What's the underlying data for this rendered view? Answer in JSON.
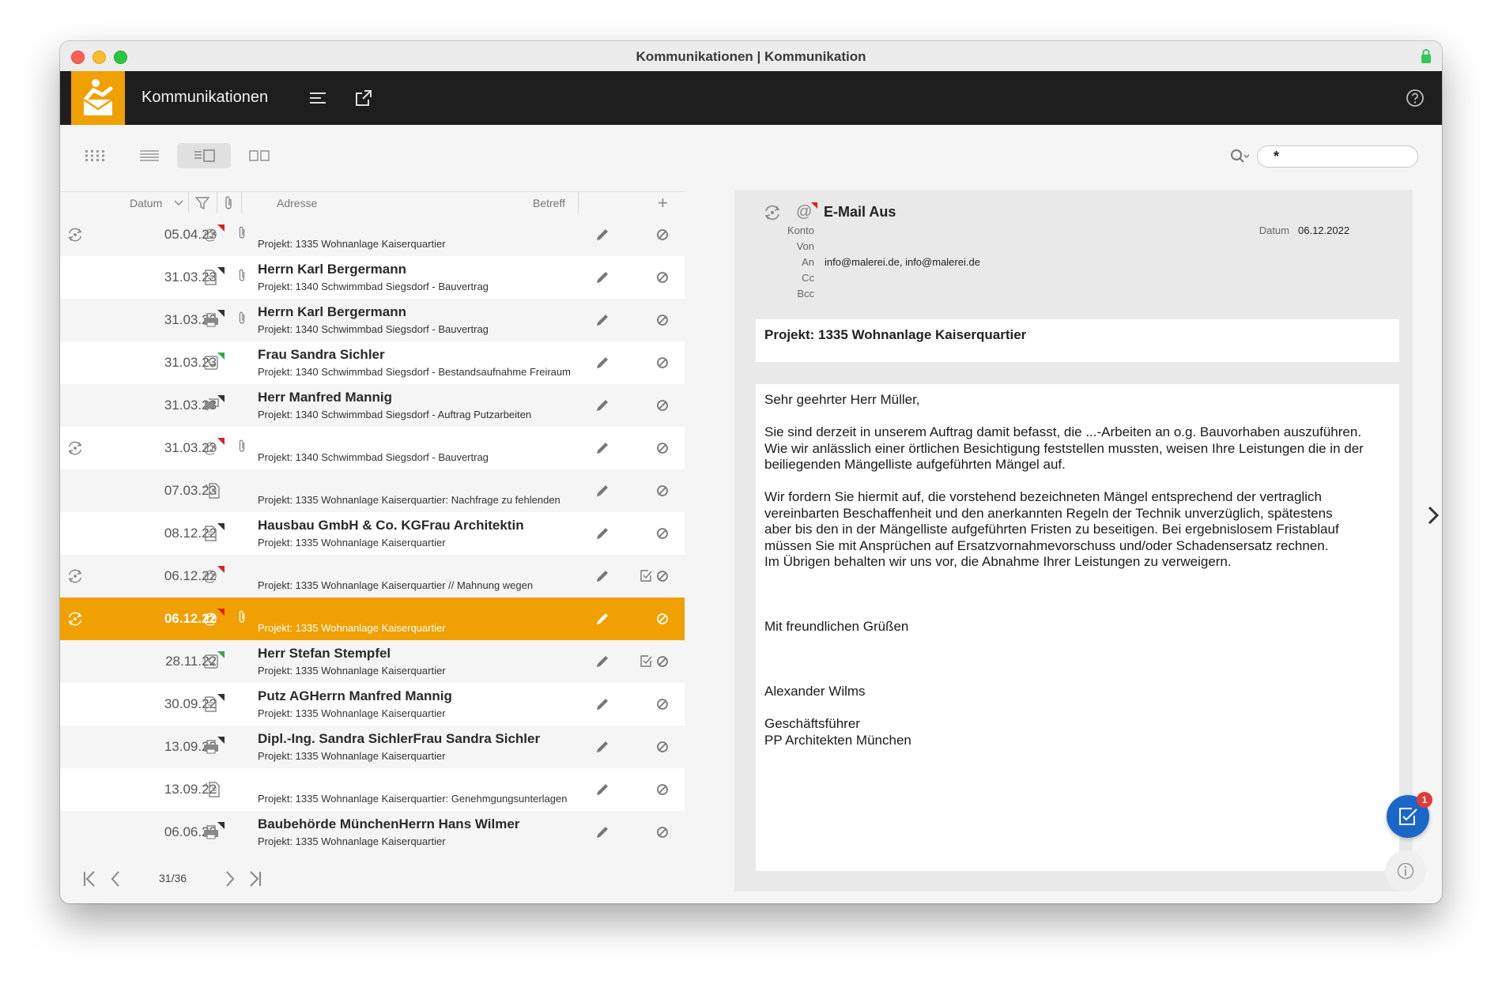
{
  "window": {
    "title": "Kommunikationen | Kommunikation"
  },
  "appbar": {
    "title": "Kommunikationen"
  },
  "search": {
    "value": "*"
  },
  "list": {
    "columns": {
      "datum": "Datum",
      "adresse": "Adresse",
      "betreff": "Betreff",
      "add": "+"
    },
    "rows": [
      {
        "date": "05.04.23",
        "type": "email",
        "flag": "red",
        "attach": true,
        "sync": true,
        "addr": "",
        "subj": "Projekt: 1335 Wohnanlage Kaiserquartier",
        "task": false
      },
      {
        "date": "31.03.23",
        "type": "doc",
        "flag": "dark",
        "attach": true,
        "sync": false,
        "addr": "Herrn Karl Bergermann",
        "subj": "Projekt: 1340 Schwimmbad Siegsdorf - Bauvertrag",
        "task": false
      },
      {
        "date": "31.03.23",
        "type": "fax",
        "flag": "dark",
        "attach": true,
        "sync": false,
        "addr": "Herrn Karl Bergermann",
        "subj": "Projekt: 1340 Schwimmbad Siegsdorf - Bauvertrag",
        "task": false
      },
      {
        "date": "31.03.23",
        "type": "phone",
        "flag": "green",
        "attach": false,
        "sync": false,
        "addr": "Frau Sandra Sichler",
        "subj": "Projekt: 1340 Schwimmbad Siegsdorf - Bestandsaufnahme Freiraum",
        "task": false
      },
      {
        "date": "31.03.23",
        "type": "chat",
        "flag": "dark",
        "attach": false,
        "sync": false,
        "addr": "Herr Manfred Mannig",
        "subj": "Projekt: 1340 Schwimmbad Siegsdorf - Auftrag Putzarbeiten",
        "task": false
      },
      {
        "date": "31.03.23",
        "type": "email",
        "flag": "red",
        "attach": true,
        "sync": true,
        "addr": "",
        "subj": "Projekt: 1340 Schwimmbad Siegsdorf - Bauvertrag",
        "task": false
      },
      {
        "date": "07.03.23",
        "type": "docin",
        "flag": "",
        "attach": false,
        "sync": false,
        "addr": "",
        "subj": "Projekt: 1335 Wohnanlage Kaiserquartier: Nachfrage zu fehlenden",
        "task": false
      },
      {
        "date": "08.12.22",
        "type": "doc",
        "flag": "dark",
        "attach": false,
        "sync": false,
        "addr": "Hausbau GmbH & Co. KGFrau Architektin",
        "subj": "Projekt: 1335 Wohnanlage Kaiserquartier",
        "task": false
      },
      {
        "date": "06.12.22",
        "type": "email",
        "flag": "red",
        "attach": false,
        "sync": true,
        "addr": "",
        "subj": "Projekt: 1335 Wohnanlage Kaiserquartier // Mahnung wegen",
        "task": true
      },
      {
        "date": "06.12.22",
        "type": "email",
        "flag": "red",
        "attach": true,
        "sync": true,
        "addr": "",
        "subj": "Projekt: 1335 Wohnanlage Kaiserquartier",
        "task": false,
        "selected": true
      },
      {
        "date": "28.11.22",
        "type": "phone",
        "flag": "green",
        "attach": false,
        "sync": false,
        "addr": "Herr Stefan Stempfel",
        "subj": "Projekt: 1335 Wohnanlage Kaiserquartier",
        "task": true
      },
      {
        "date": "30.09.22",
        "type": "doc",
        "flag": "dark",
        "attach": false,
        "sync": false,
        "addr": "Putz AGHerrn Manfred Mannig",
        "subj": "Projekt: 1335 Wohnanlage Kaiserquartier",
        "task": false
      },
      {
        "date": "13.09.22",
        "type": "fax",
        "flag": "dark",
        "attach": false,
        "sync": false,
        "addr": "Dipl.-Ing. Sandra SichlerFrau Sandra Sichler",
        "subj": "Projekt: 1335 Wohnanlage Kaiserquartier",
        "task": false
      },
      {
        "date": "13.09.22",
        "type": "docin",
        "flag": "",
        "attach": false,
        "sync": false,
        "addr": "",
        "subj": "Projekt: 1335 Wohnanlage Kaiserquartier: Genehmgungsunterlagen",
        "task": false
      },
      {
        "date": "06.06.22",
        "type": "fax",
        "flag": "dark",
        "attach": false,
        "sync": false,
        "addr": "Baubehörde MünchenHerrn Hans Wilmer",
        "subj": "Projekt: 1335 Wohnanlage Kaiserquartier",
        "task": false
      }
    ]
  },
  "pagination": {
    "current": "31/36"
  },
  "detail": {
    "title": "E-Mail Aus",
    "labels": {
      "konto": "Konto",
      "von": "Von",
      "an": "An",
      "cc": "Cc",
      "bcc": "Bcc",
      "datum": "Datum"
    },
    "an": "info@malerei.de, info@malerei.de",
    "datum": "06.12.2022",
    "subject": "Projekt: 1335 Wohnanlage Kaiserquartier",
    "body": [
      "Sehr geehrter Herr Müller,",
      "",
      "Sie sind derzeit in unserem Auftrag damit befasst, die ...-Arbeiten an o.g. Bauvorhaben auszuführen.",
      "Wie wir anlässlich einer örtlichen Besichtigung feststellen mussten, weisen Ihre Leistungen die in der",
      "beiliegenden Mängelliste aufgeführten Mängel auf.",
      "",
      "Wir fordern Sie hiermit auf, die vorstehend bezeichneten Mängel entsprechend der vertraglich",
      "vereinbarten Beschaffenheit und den anerkannten Regeln der Technik unverzüglich, spätestens",
      "aber bis den in der Mängelliste aufgeführten Fristen zu beseitigen. Bei ergebnislosem Fristablauf",
      "müssen Sie mit Ansprüchen auf Ersatzvornahmevorschuss und/oder Schadensersatz rechnen.",
      "Im Übrigen behalten wir uns vor, die Abnahme Ihrer Leistungen zu verweigern.",
      "",
      "",
      "",
      "Mit freundlichen Grüßen",
      "",
      "",
      "",
      "Alexander Wilms",
      "",
      "Geschäftsführer",
      "PP Architekten München"
    ]
  },
  "fab": {
    "badge": "1"
  },
  "colors": {
    "accent": "#f0a000",
    "appbar": "#1e1e1e",
    "fab": "#1b67c9",
    "badge": "#e53935"
  }
}
